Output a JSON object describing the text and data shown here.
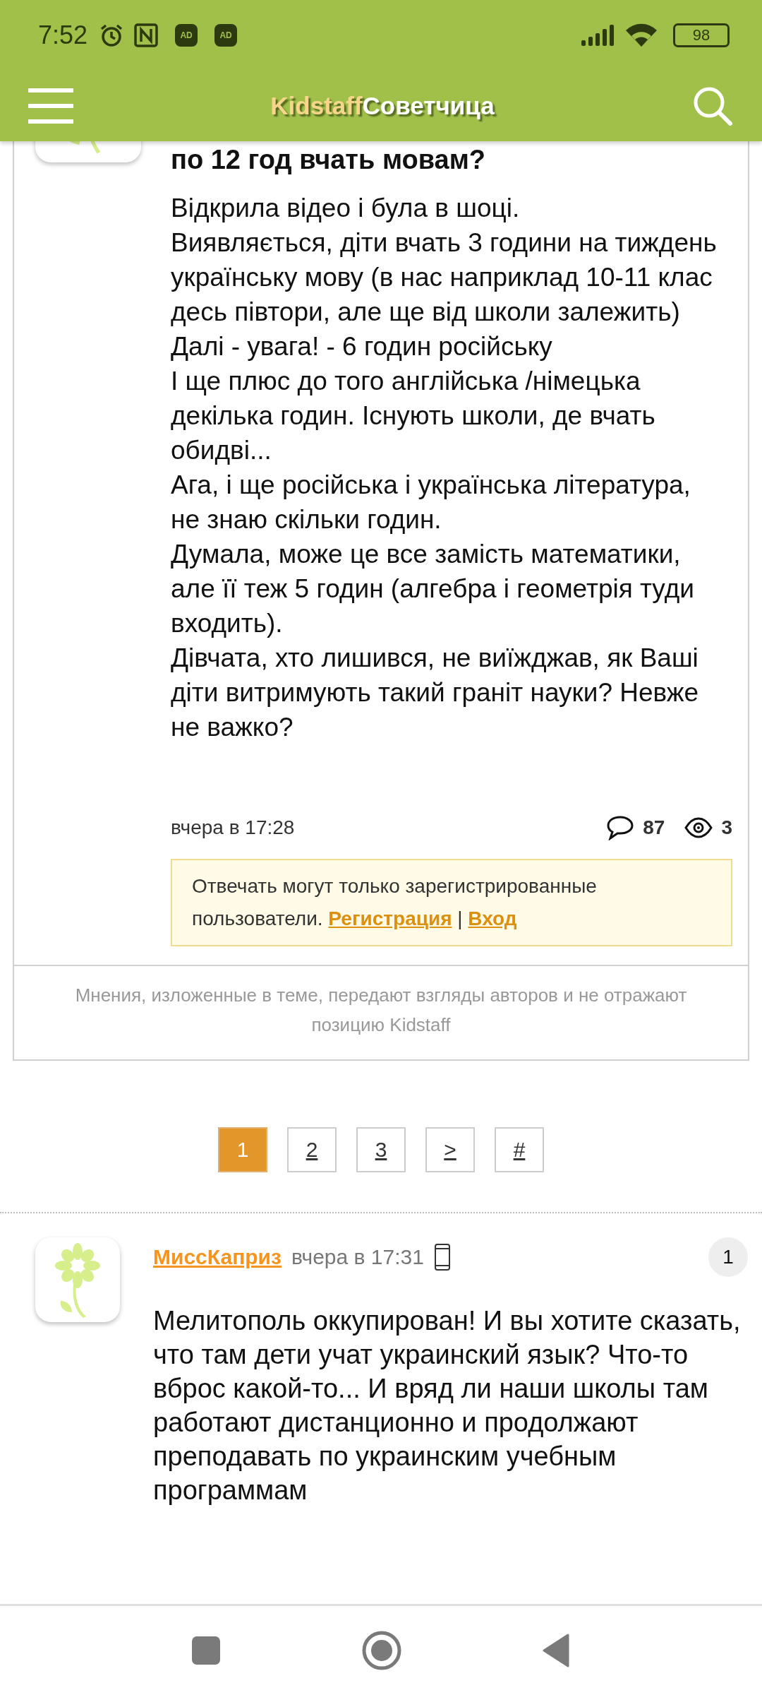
{
  "status_bar": {
    "time": "7:52",
    "ad_badges": [
      "AD",
      "AD"
    ],
    "battery": "98"
  },
  "header": {
    "logo_brand": "Kidstaff",
    "logo_section": "Советчица"
  },
  "post": {
    "title": "по 12 год вчать мовам?",
    "paragraphs": [
      "Відкрила відео і була в шоці.",
      "Виявляється, діти вчать 3 години на тиждень українську мову (в нас наприклад 10-11 клас десь півтори, але ще від школи залежить)",
      "Далі - увага! - 6 годин російську",
      "І ще плюс до того англійська /німецька декілька годин. Існують школи, де вчать обидві...",
      "Ага, і ще російська і українська література, не знаю скільки годин.",
      "Думала, може це все замість математики, але її теж 5 годин (алгебра і геометрія туди входить).",
      "Дівчата, хто лишився, не виїжджав, як Ваші діти витримують такий граніт науки? Невже не важко?"
    ],
    "date": "вчера в 17:28",
    "comments": "87",
    "views": "3",
    "notice": {
      "text": "Отвечать могут только зарегистрированные пользователи.",
      "register_link": "Регистрация",
      "separator": "|",
      "login_link": "Вход"
    },
    "disclaimer": "Мнения, изложенные в теме, передают взгляды авторов и не отражают позицию Kidstaff"
  },
  "pagination": [
    {
      "label": "1",
      "selected": true
    },
    {
      "label": "2",
      "selected": false
    },
    {
      "label": "3",
      "selected": false
    },
    {
      "label": ">",
      "selected": false
    },
    {
      "label": "#",
      "selected": false
    }
  ],
  "comments": [
    {
      "author": "МиссКаприз",
      "time": "вчера в 17:31",
      "number": "1",
      "text": "Мелитополь оккупирован! И вы хотите сказать, что там дети учат украинский язык? Что-то вброс какой-то... И вряд ли наши школы там работают дистанционно и продолжают преподавать по украинским учебным программам"
    }
  ]
}
